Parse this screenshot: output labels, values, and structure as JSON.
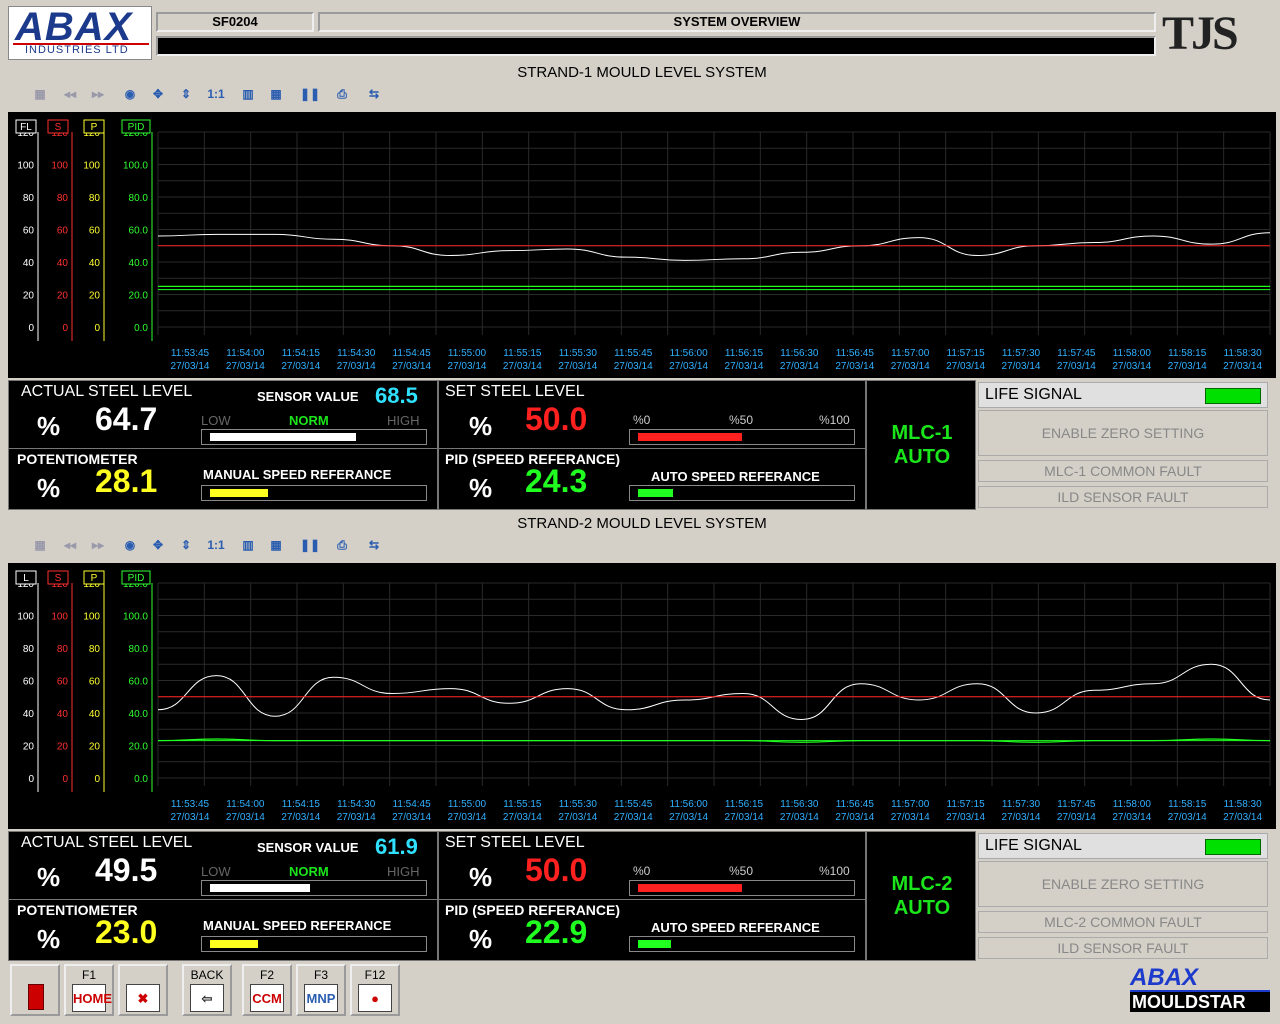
{
  "header": {
    "logo_main": "ABAX",
    "logo_sub": "INDUSTRIES LTD",
    "station": "SF0204",
    "title": "SYSTEM OVERVIEW",
    "status_line": "",
    "brand_right": "TJS"
  },
  "ticks_x": [
    "11:53:45",
    "11:54:00",
    "11:54:15",
    "11:54:30",
    "11:54:45",
    "11:55:00",
    "11:55:15",
    "11:55:30",
    "11:55:45",
    "11:56:00",
    "11:56:15",
    "11:56:30",
    "11:56:45",
    "11:57:00",
    "11:57:15",
    "11:57:30",
    "11:57:45",
    "11:58:00",
    "11:58:15",
    "11:58:30"
  ],
  "tick_date": "27/03/14",
  "axis_ticks": [
    "120",
    "100",
    "80",
    "60",
    "40",
    "20",
    "0"
  ],
  "axis_ticks_pid": [
    "120.0",
    "100.0",
    "80.0",
    "60.0",
    "40.0",
    "20.0",
    "0.0"
  ],
  "colors": {
    "actual": "#ffffff",
    "set": "#ff2020",
    "pid": "#20ff20",
    "sensor": "#30e0ff",
    "pot": "#ffff20",
    "life": "#00e000"
  },
  "strands": [
    {
      "title": "STRAND-1 MOULD LEVEL SYSTEM",
      "axis_tags": [
        "FL",
        "S",
        "P",
        "PID"
      ],
      "actual_label": "ACTUAL STEEL LEVEL",
      "actual_unit": "%",
      "actual_value": "64.7",
      "sensor_label": "SENSOR VALUE",
      "sensor_value": "68.5",
      "low": "LOW",
      "norm": "NORM",
      "high": "HIGH",
      "sensor_fill": 0.73,
      "set_label": "SET STEEL LEVEL",
      "set_unit": "%",
      "set_value": "50.0",
      "set_fill": 0.5,
      "scale0": "%0",
      "scale50": "%50",
      "scale100": "%100",
      "pot_label": "POTENTIOMETER",
      "pot_unit": "%",
      "pot_value": "28.1",
      "manual_label": "MANUAL SPEED REFERANCE",
      "manual_fill": 0.28,
      "pid_label": "PID (SPEED REFERANCE)",
      "pid_unit": "%",
      "pid_value": "24.3",
      "auto_label": "AUTO SPEED REFERANCE",
      "auto_fill": 0.17,
      "mlc": "MLC-1",
      "mode": "AUTO",
      "life": "LIFE SIGNAL",
      "zero": "ENABLE ZERO SETTING",
      "fault": "MLC-1 COMMON FAULT",
      "ild": "ILD SENSOR FAULT",
      "chart_data": {
        "type": "line",
        "x": [
          "11:53:45",
          "11:54:00",
          "11:54:15",
          "11:54:30",
          "11:54:45",
          "11:55:00",
          "11:55:15",
          "11:55:30",
          "11:55:45",
          "11:56:00",
          "11:56:15",
          "11:56:30",
          "11:56:45",
          "11:57:00",
          "11:57:15",
          "11:57:30",
          "11:57:45",
          "11:58:00",
          "11:58:15",
          "11:58:30"
        ],
        "ylim": [
          0,
          120
        ],
        "series": [
          {
            "values": [
              56,
              57,
              57,
              54,
              50,
              44,
              47,
              48,
              43,
              41,
              42,
              46,
              50,
              55,
              44,
              50,
              52,
              56,
              51,
              58
            ]
          },
          {
            "values": [
              50,
              50,
              50,
              50,
              50,
              50,
              50,
              50,
              50,
              50,
              50,
              50,
              50,
              50,
              50,
              50,
              50,
              50,
              50,
              50
            ]
          },
          {
            "values": [
              25,
              25,
              25,
              25,
              25,
              25,
              25,
              25,
              25,
              25,
              25,
              25,
              25,
              25,
              25,
              25,
              25,
              25,
              25,
              25
            ]
          },
          {
            "values": [
              23,
              23,
              23,
              23,
              23,
              23,
              23,
              23,
              23,
              23,
              23,
              23,
              23,
              23,
              23,
              23,
              23,
              23,
              23,
              23
            ]
          }
        ]
      }
    },
    {
      "title": "STRAND-2 MOULD LEVEL SYSTEM",
      "axis_tags": [
        "L",
        "S",
        "P",
        "PID"
      ],
      "actual_label": "ACTUAL STEEL LEVEL",
      "actual_unit": "%",
      "actual_value": "49.5",
      "sensor_label": "SENSOR VALUE",
      "sensor_value": "61.9",
      "low": "LOW",
      "norm": "NORM",
      "high": "HIGH",
      "sensor_fill": 0.5,
      "set_label": "SET STEEL LEVEL",
      "set_unit": "%",
      "set_value": "50.0",
      "set_fill": 0.5,
      "scale0": "%0",
      "scale50": "%50",
      "scale100": "%100",
      "pot_label": "POTENTIOMETER",
      "pot_unit": "%",
      "pot_value": "23.0",
      "manual_label": "MANUAL SPEED REFERANCE",
      "manual_fill": 0.23,
      "pid_label": "PID (SPEED REFERANCE)",
      "pid_unit": "%",
      "pid_value": "22.9",
      "auto_label": "AUTO SPEED REFERANCE",
      "auto_fill": 0.16,
      "mlc": "MLC-2",
      "mode": "AUTO",
      "life": "LIFE SIGNAL",
      "zero": "ENABLE ZERO SETTING",
      "fault": "MLC-2 COMMON FAULT",
      "ild": "ILD SENSOR FAULT",
      "chart_data": {
        "type": "line",
        "x": [
          "11:53:45",
          "11:54:00",
          "11:54:15",
          "11:54:30",
          "11:54:45",
          "11:55:00",
          "11:55:15",
          "11:55:30",
          "11:55:45",
          "11:56:00",
          "11:56:15",
          "11:56:30",
          "11:56:45",
          "11:57:00",
          "11:57:15",
          "11:57:30",
          "11:57:45",
          "11:58:00",
          "11:58:15",
          "11:58:30"
        ],
        "ylim": [
          0,
          120
        ],
        "series": [
          {
            "values": [
              42,
              63,
              38,
              62,
              52,
              55,
              46,
              55,
              42,
              48,
              52,
              36,
              58,
              48,
              58,
              40,
              54,
              58,
              70,
              48
            ]
          },
          {
            "values": [
              50,
              50,
              50,
              50,
              50,
              50,
              50,
              50,
              50,
              50,
              50,
              50,
              50,
              50,
              50,
              50,
              50,
              50,
              50,
              50
            ]
          },
          {
            "values": [
              23,
              24,
              23,
              23,
              23,
              23,
              23,
              23,
              23,
              23,
              23,
              22,
              23,
              23,
              23,
              22,
              23,
              23,
              24,
              23
            ]
          },
          {
            "values": [
              23,
              23,
              23,
              23,
              23,
              23,
              23,
              23,
              23,
              23,
              23,
              23,
              23,
              23,
              23,
              23,
              23,
              23,
              23,
              23
            ]
          }
        ]
      }
    }
  ],
  "footer": {
    "keys": [
      {
        "key": "",
        "label": "EXIT",
        "icon": "exit-door-icon"
      },
      {
        "key": "F1",
        "label": "HOME"
      },
      {
        "key": "",
        "label": "",
        "icon": "alarm-mute-icon"
      },
      {
        "key": "BACK",
        "label": "",
        "icon": "back-arrow-icon"
      },
      {
        "key": "F2",
        "label": "CCM"
      },
      {
        "key": "F3",
        "label": "MNP"
      },
      {
        "key": "F12",
        "label": "",
        "icon": "emergency-icon"
      }
    ],
    "brand_top": "ABAX",
    "brand_bottom": "MOULDSTAR"
  }
}
